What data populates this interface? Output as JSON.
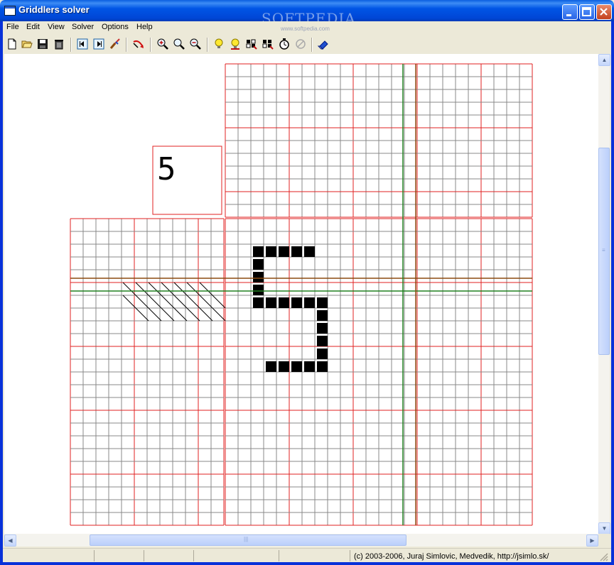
{
  "window": {
    "title": "Griddlers solver"
  },
  "watermark": {
    "text": "SOFTPEDIA",
    "small": "www.softpedia.com"
  },
  "menu": [
    "File",
    "Edit",
    "View",
    "Solver",
    "Options",
    "Help"
  ],
  "toolbar": {
    "icons": [
      "new-file-icon",
      "open-folder-icon",
      "save-icon",
      "delete-icon",
      "step-back-icon",
      "step-forward-icon",
      "brush-icon",
      "undo-arrow-icon",
      "zoom-in-icon",
      "zoom-normal-icon",
      "zoom-out-icon",
      "hint-bulb-icon",
      "hint-bulb-alt-icon",
      "solve-icon",
      "solve-all-icon",
      "timer-icon",
      "stop-icon",
      "eraser-icon"
    ]
  },
  "status": {
    "text": "(c) 2003-2006, Juraj Simlovic, Medvedik, http://jsimlo.sk/"
  },
  "puzzle": {
    "preview_glyph": "5",
    "accent_red": "#e02020",
    "accent_green": "#208020",
    "accent_brown": "#8b4a10",
    "grid_lines": "#888888",
    "filled_cells": [
      [
        14,
        2
      ],
      [
        15,
        2
      ],
      [
        16,
        2
      ],
      [
        17,
        2
      ],
      [
        18,
        2
      ],
      [
        14,
        3
      ],
      [
        14,
        4
      ],
      [
        14,
        5
      ],
      [
        14,
        6
      ],
      [
        15,
        6
      ],
      [
        16,
        6
      ],
      [
        17,
        6
      ],
      [
        18,
        6
      ],
      [
        19,
        6
      ],
      [
        19,
        7
      ],
      [
        19,
        8
      ],
      [
        19,
        9
      ],
      [
        19,
        10
      ],
      [
        15,
        11
      ],
      [
        16,
        11
      ],
      [
        17,
        11
      ],
      [
        18,
        11
      ],
      [
        19,
        11
      ]
    ],
    "hatched_cells": [
      [
        4,
        5
      ],
      [
        5,
        5
      ],
      [
        6,
        5
      ],
      [
        7,
        5
      ],
      [
        8,
        5
      ],
      [
        9,
        5
      ],
      [
        10,
        5
      ],
      [
        4,
        6
      ],
      [
        5,
        6
      ],
      [
        6,
        6
      ],
      [
        7,
        6
      ],
      [
        8,
        6
      ],
      [
        9,
        6
      ],
      [
        10,
        6
      ],
      [
        11,
        6
      ],
      [
        5,
        7
      ],
      [
        6,
        7
      ],
      [
        7,
        7
      ],
      [
        8,
        7
      ],
      [
        9,
        7
      ],
      [
        10,
        7
      ],
      [
        11,
        7
      ]
    ]
  }
}
